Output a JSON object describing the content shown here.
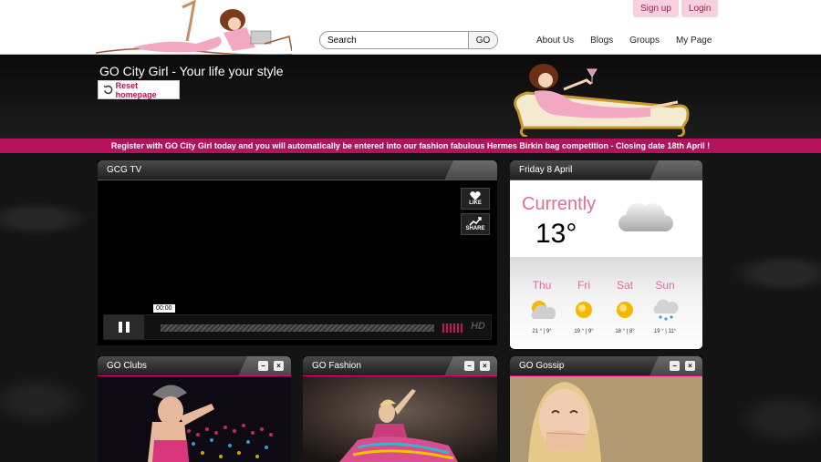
{
  "auth": {
    "signup": "Sign up",
    "login": "Login"
  },
  "search": {
    "placeholder": "Search",
    "go": "GO"
  },
  "nav": [
    "About Us",
    "Blogs",
    "Groups",
    "My Page"
  ],
  "site": {
    "title": "GO City Girl - Your life your style",
    "reset": "Reset homepage"
  },
  "promo": "Register with GO City Girl today and you will automatically be entered into our fashion fabulous Hermes Birkin bag competition - Closing date 18th April !",
  "tv": {
    "title": "GCG TV",
    "like": "LIKE",
    "share": "SHARE",
    "time": "00:00",
    "hd": "HD"
  },
  "weather": {
    "date": "Friday 8 April",
    "currently": "Currently",
    "temp": "13°",
    "days": [
      {
        "name": "Thu",
        "range": "21 ° | 9°",
        "icon": "partly-cloudy-icon"
      },
      {
        "name": "Fri",
        "range": "19 ° | 9°",
        "icon": "sun-icon"
      },
      {
        "name": "Sat",
        "range": "18 ° | 8°",
        "icon": "sun-icon"
      },
      {
        "name": "Sun",
        "range": "19 ° | 11°",
        "icon": "rain-cloud-icon"
      }
    ]
  },
  "panels": {
    "clubs": "GO Clubs",
    "fashion": "GO Fashion",
    "gossip": "GO Gossip"
  },
  "colors": {
    "accent": "#b5125a",
    "pink_text": "#e26b9c",
    "pill_bg": "#f7d0dd"
  }
}
